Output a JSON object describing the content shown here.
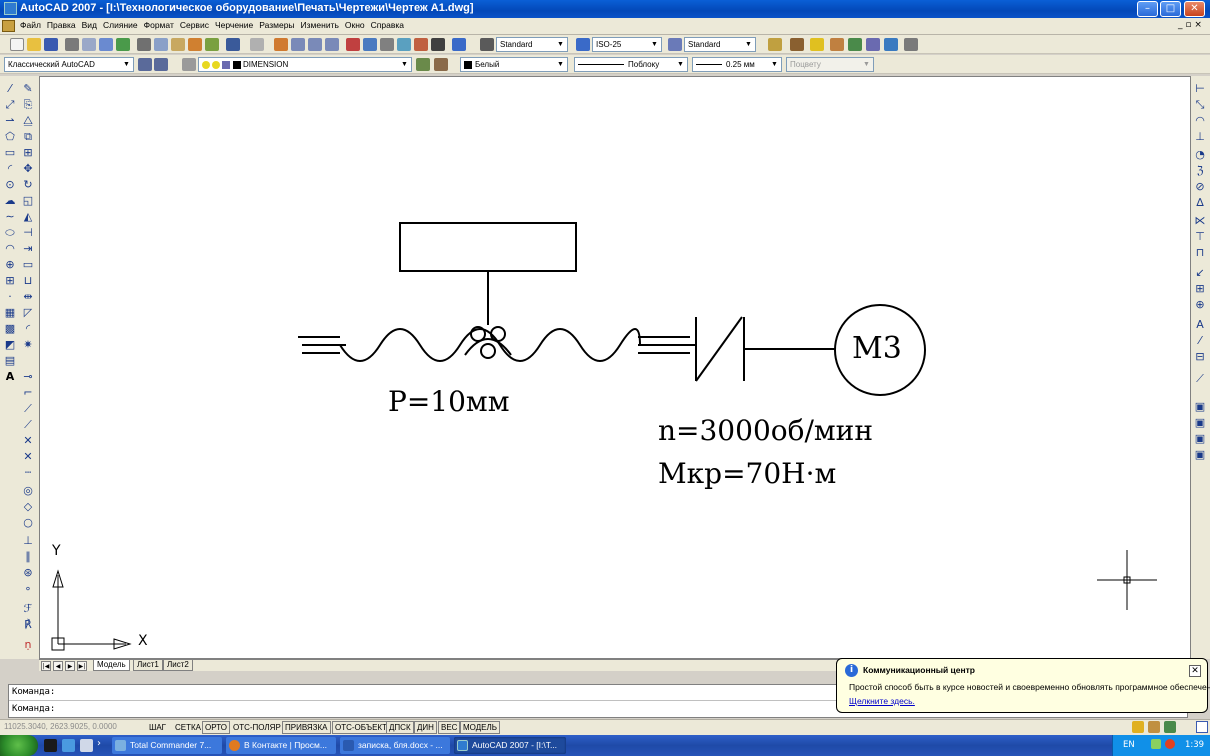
{
  "window": {
    "title": "AutoCAD 2007 - [I:\\Технологическое оборудование\\Печать\\Чертежи\\Чертеж А1.dwg]",
    "minimize": "–",
    "maximize": "□",
    "close": "✕",
    "doc_controls": "_ ▫ ×"
  },
  "menu": [
    "Файл",
    "Правка",
    "Вид",
    "Слияние",
    "Формат",
    "Сервис",
    "Черчение",
    "Размеры",
    "Изменить",
    "Окно",
    "Справка"
  ],
  "toolbar": {
    "text_style": "Standard",
    "dim_style": "ISO-25",
    "table_style": "Standard",
    "workspace": "Классический AutoCAD",
    "layer": "DIMENSION",
    "color": "Белый",
    "linetype": "Поблоку",
    "lineweight": "0.25 мм",
    "plotstyle": "Поцвету"
  },
  "drawing": {
    "pitch_label": "Р=10мм",
    "motor_label": "М3",
    "speed_label": "n=3000об/мин",
    "torque_label": "Мкр=70Н·м",
    "ucs_x": "X",
    "ucs_y": "Y"
  },
  "layout_tabs": [
    "Модель",
    "Лист1",
    "Лист2"
  ],
  "command": {
    "line1": "Команда:",
    "line2": "Команда:"
  },
  "status": {
    "coords": "11025.3040, 2623.9025, 0.0000",
    "buttons": [
      "ШАГ",
      "СЕТКА",
      "ОРТО",
      "ОТС-ПОЛЯР",
      "ПРИВЯЗКА",
      "ОТС-ОБЪЕКТ",
      "ДПСК",
      "ДИН",
      "ВЕС",
      "МОДЕЛЬ"
    ]
  },
  "balloon": {
    "title": "Коммуникационный центр",
    "body": "Простой способ быть в курсе новостей и своевременно обновлять программное обеспечение.",
    "link": "Щелкните здесь.",
    "close": "✕"
  },
  "taskbar": {
    "tasks": [
      "Total Commander 7...",
      "В Контакте | Просм...",
      "записка, бля.docx - ...",
      "AutoCAD 2007 - [I:\\T..."
    ],
    "lang": "EN",
    "clock": "1:39"
  }
}
